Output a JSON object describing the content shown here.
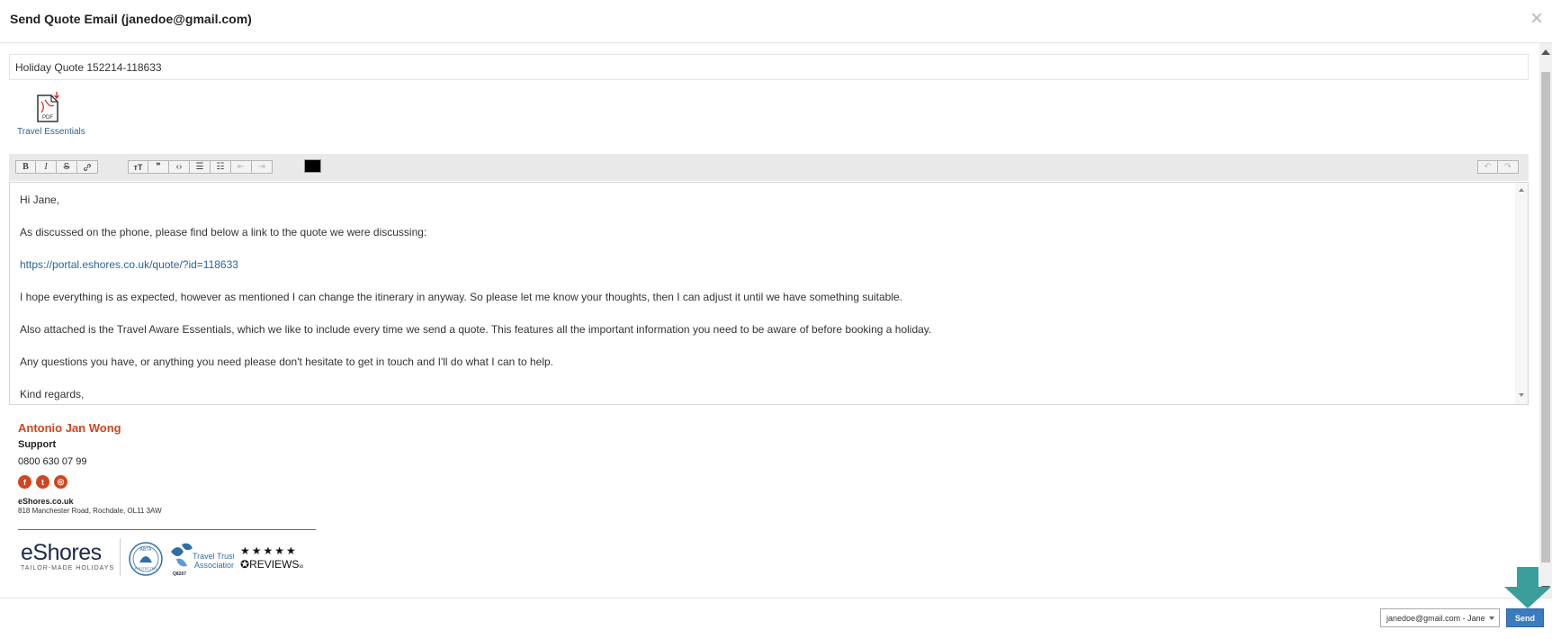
{
  "dialog": {
    "title": "Send Quote Email (janedoe@gmail.com)",
    "close_glyph": "×"
  },
  "subject": {
    "value": "Holiday Quote 152214-118633"
  },
  "attachment": {
    "label": "Travel Essentials",
    "icon": "pdf-file-icon",
    "icon_text": "PDF"
  },
  "toolbar": {
    "left_buttons": [
      {
        "name": "bold-button",
        "glyph": "B",
        "icon": "bold-icon"
      },
      {
        "name": "italic-button",
        "glyph": "I",
        "icon": "italic-icon"
      },
      {
        "name": "strikethrough-button",
        "glyph": "S",
        "icon": "strikethrough-icon"
      },
      {
        "name": "link-button",
        "glyph": "🔗",
        "icon": "link-icon"
      }
    ],
    "block_buttons": [
      {
        "name": "heading-button",
        "glyph": "тT",
        "icon": "heading-icon"
      },
      {
        "name": "quote-button",
        "glyph": "❞",
        "icon": "quote-icon"
      },
      {
        "name": "code-button",
        "glyph": "‹›",
        "icon": "code-icon"
      },
      {
        "name": "bullet-list-button",
        "glyph": "☰",
        "icon": "bullet-list-icon"
      },
      {
        "name": "numbered-list-button",
        "glyph": "☷",
        "icon": "numbered-list-icon"
      },
      {
        "name": "outdent-button",
        "glyph": "⇤",
        "icon": "outdent-icon"
      },
      {
        "name": "indent-button",
        "glyph": "⇥",
        "icon": "indent-icon"
      }
    ],
    "text_color": "#000000",
    "history_buttons": [
      {
        "name": "undo-button",
        "glyph": "↶",
        "icon": "undo-icon"
      },
      {
        "name": "redo-button",
        "glyph": "↷",
        "icon": "redo-icon"
      }
    ]
  },
  "editor": {
    "greeting": "Hi Jane,",
    "para1": "As discussed on the phone, please find below a link to the quote we were discussing:",
    "quote_link": "https://portal.eshores.co.uk/quote/?id=118633",
    "para2": "I hope everything is as expected, however as mentioned I can change the itinerary in anyway. So please let me know your thoughts, then I can adjust it until we have something suitable.",
    "para3": "Also attached is the Travel Aware Essentials, which we like to include every time we send a quote. This features all the important information you need to be aware of before booking a holiday.",
    "para4": "Any questions you have, or anything you need please don't hesitate to get in touch and I'll do what I can to help.",
    "closing": "Kind regards,"
  },
  "signature": {
    "name": "Antonio Jan Wong",
    "role": "Support",
    "phone": "0800 630 07 99",
    "social": [
      {
        "name": "facebook-icon",
        "glyph": "f"
      },
      {
        "name": "twitter-icon",
        "glyph": "t"
      },
      {
        "name": "instagram-icon",
        "glyph": "◎"
      }
    ],
    "company": "eShores.co.uk",
    "address": "818 Manchester Road, Rochdale, OL11 3AW",
    "accent_color": "#d2451e",
    "logos": {
      "eshores": "eShores",
      "eshores_tagline": "TAILOR-MADE HOLIDAYS",
      "abta": "ABTA",
      "abta_sub": "PROTECTED",
      "ttaid": "Q8267",
      "tta_line1": "Travel Trust",
      "tta_line2": "Association",
      "stars": "★★★★★",
      "reviews": "REVIEWS",
      "reviews_suffix": "io"
    }
  },
  "footer": {
    "from_value": "janedoe@gmail.com - Jane",
    "send_label": "Send",
    "send_color": "#3b7bbf",
    "arrow_color": "#3a9e9a"
  }
}
